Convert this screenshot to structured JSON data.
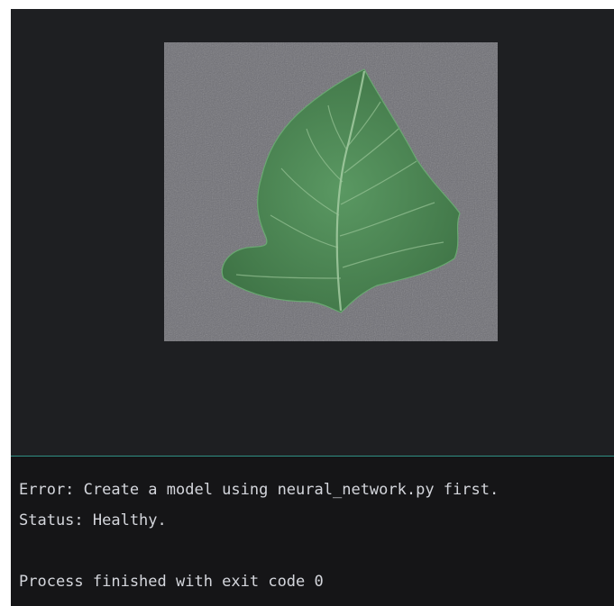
{
  "preview": {
    "image_subject": "green tomato leaf on gray textured background",
    "background_color": "#6e6e74",
    "leaf_color": "#4f8a55"
  },
  "console": {
    "lines": [
      "Error: Create a model using neural_network.py first.",
      "Status: Healthy.",
      "",
      "Process finished with exit code 0"
    ]
  },
  "colors": {
    "panel_bg": "#1e1f22",
    "console_bg": "#151517",
    "divider": "#2f8f83",
    "text": "#d4d6dc"
  }
}
